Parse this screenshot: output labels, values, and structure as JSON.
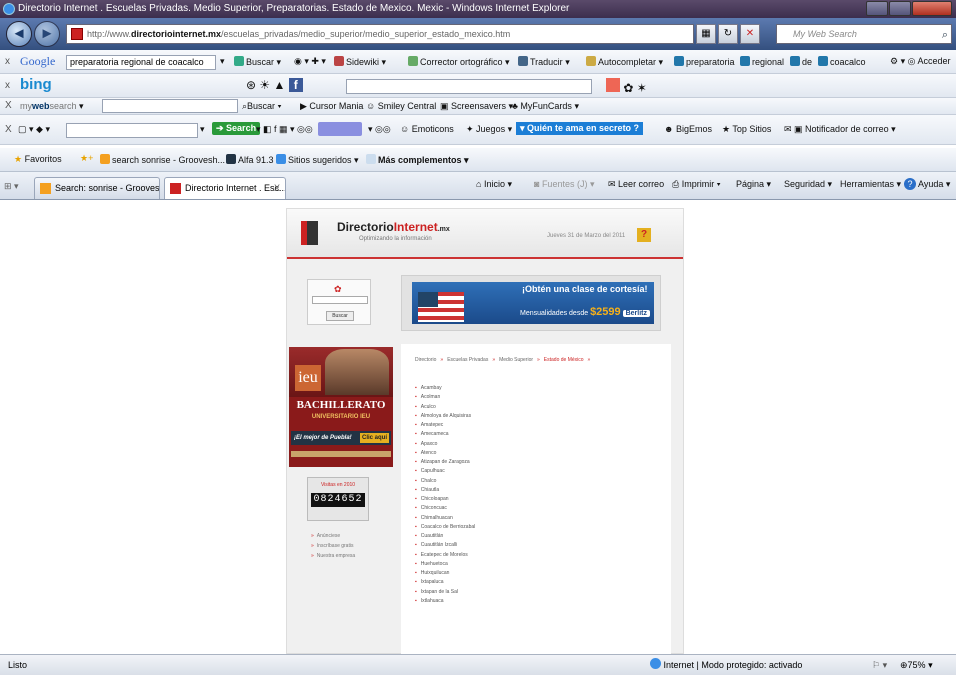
{
  "window": {
    "title": "Directorio Internet . Escuelas Privadas. Medio Superior, Preparatorias. Estado de Mexico. Mexic - Windows Internet Explorer"
  },
  "address_bar": {
    "url_prefix": "http://www.",
    "url_domain": "directoriointernet.mx",
    "url_path": "/escuelas_privadas/medio_superior/medio_superior_estado_mexico.htm",
    "search_placeholder": "My Web Search"
  },
  "google_toolbar": {
    "label": "Google",
    "query": "preparatoria regional de coacalco",
    "buscar": "Buscar",
    "sidewiki": "Sidewiki",
    "corrector": "Corrector ortográfico",
    "traducir": "Traducir",
    "autocompletar": "Autocompletar",
    "terms": [
      "preparatoria",
      "regional",
      "de",
      "coacalco"
    ],
    "acceder": "Acceder"
  },
  "bing_toolbar": {
    "label": "bing"
  },
  "mywebsearch_toolbar": {
    "label_my": "my",
    "label_web": "web",
    "label_search": "search",
    "buscar": "Buscar",
    "cursor_mania": "Cursor Mania",
    "smiley_central": "Smiley Central",
    "screensavers": "Screensavers",
    "myfuncards": "MyFunCards"
  },
  "toolbar4": {
    "search_btn": "Search",
    "emoticons": "Emoticons",
    "juegos": "Juegos",
    "quien": "▾ Quién te ama en secreto ?",
    "bigemos": "BigEmos",
    "top_sitios": "Top Sitios",
    "notificador": "Notificador de correo"
  },
  "favorites_bar": {
    "favoritos": "Favoritos",
    "items": [
      "search sonrise - Groovesh...",
      "Alfa 91.3",
      "Sitios sugeridos",
      "Más complementos"
    ]
  },
  "tabs": [
    {
      "label": "Search: sonrise - Groovesh..."
    },
    {
      "label": "Directorio Internet . Esc..."
    }
  ],
  "command_bar": {
    "inicio": "Inicio",
    "fuentes": "Fuentes (J)",
    "leer_correo": "Leer correo",
    "imprimir": "Imprimir",
    "pagina": "Página",
    "seguridad": "Seguridad",
    "herramientas": "Herramientas",
    "ayuda": "Ayuda"
  },
  "site": {
    "logo_part1": "Directorio",
    "logo_part2": "Internet",
    "logo_mx": ".mx",
    "tagline": "Optimizando la información",
    "date": "Jueves 31 de Marzo del 2011",
    "help": "?",
    "search_button": "Buscar",
    "banner": {
      "headline": "¡Obtén una clase de cortesía!",
      "offer": "Mensualidades desde",
      "price": "$2599",
      "brand": "Berlitz"
    },
    "ad": {
      "logo": "ieu",
      "title": "BACHILLERATO",
      "subtitle": "UNIVERSITARIO IEU",
      "slogan": "¡El mejor de Puebla!",
      "cta": "Clic aquí"
    },
    "visits_label": "Visitas en 2010",
    "visits": "0824652",
    "side_links": [
      "Anúnciese",
      "Inscríbase gratis",
      "Nuestra empresa"
    ],
    "breadcrumb": [
      "Directorio",
      "Escuelas Privadas",
      "Medio Superior",
      "Estado de México"
    ],
    "municipios": [
      "Acambay",
      "Acolman",
      "Aculco",
      "Almoloya de Alquisiras",
      "Amatepec",
      "Amecameca",
      "Apaxco",
      "Atenco",
      "Atizapan de Zaragoza",
      "Capulhuac",
      "Chalco",
      "Chiautla",
      "Chicoloapan",
      "Chiconcuac",
      "Chimalhuacan",
      "Coacalco de Berriozabal",
      "Cuautitlán",
      "Cuautitlán Izcalli",
      "Ecatepec de Morelos",
      "Huehuetoca",
      "Huixquilucan",
      "Ixtapaluca",
      "Ixtapan de la Sal",
      "Ixtlahuaca"
    ]
  },
  "status_bar": {
    "left": "Listo",
    "zone": "Internet | Modo protegido: activado",
    "zoom": "75%"
  }
}
